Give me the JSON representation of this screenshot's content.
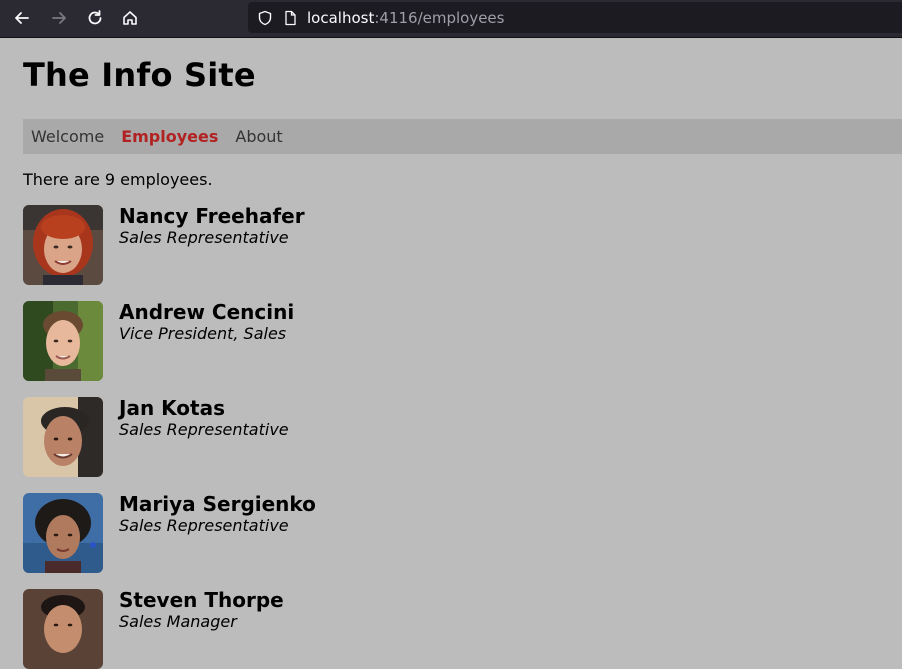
{
  "browser": {
    "url_host": "localhost",
    "url_path": ":4116/employees",
    "icons": [
      "back-arrow-icon",
      "forward-arrow-icon",
      "reload-icon",
      "home-icon",
      "shield-icon",
      "page-icon"
    ]
  },
  "site": {
    "title": "The Info Site"
  },
  "nav": {
    "items": [
      {
        "label": "Welcome"
      },
      {
        "label": "Employees"
      },
      {
        "label": "About"
      }
    ],
    "active_index": 1,
    "active_color": "#b22222"
  },
  "summary": {
    "text": "There are 9 employees."
  },
  "employees": [
    {
      "name": "Nancy Freehafer",
      "title": "Sales Representative"
    },
    {
      "name": "Andrew Cencini",
      "title": "Vice President, Sales"
    },
    {
      "name": "Jan Kotas",
      "title": "Sales Representative"
    },
    {
      "name": "Mariya Sergienko",
      "title": "Sales Representative"
    },
    {
      "name": "Steven Thorpe",
      "title": "Sales Manager"
    }
  ],
  "colors": {
    "page_background": "#bcbcbc",
    "nav_background": "#a9a9a9",
    "browser_chrome": "#2b2a33"
  }
}
